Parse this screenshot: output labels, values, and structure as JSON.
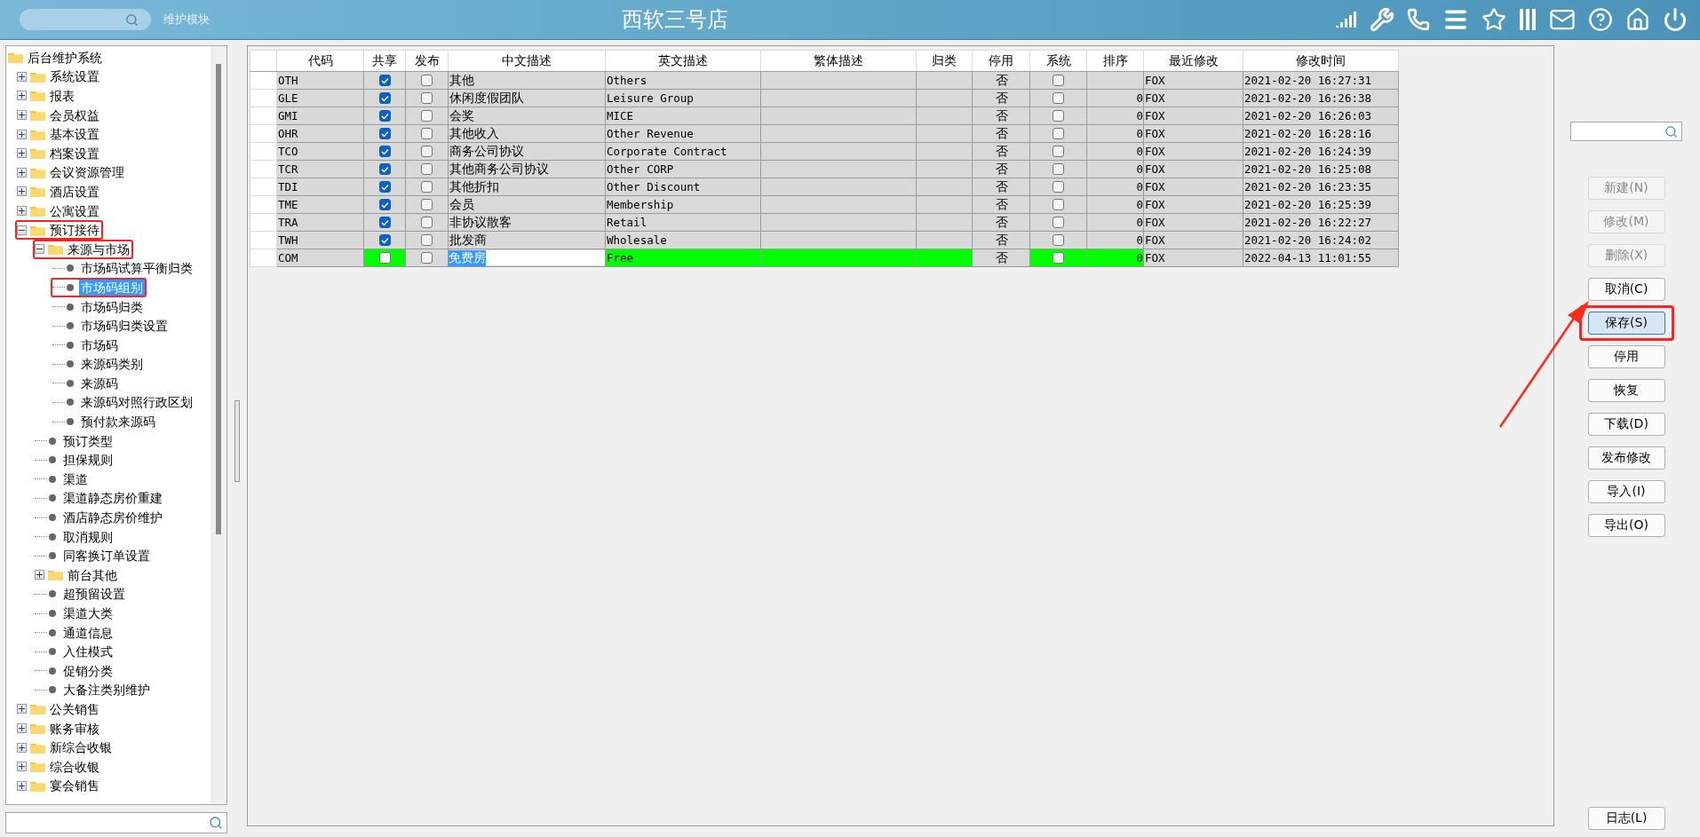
{
  "header": {
    "module_label": "维护模块",
    "title": "西软三号店"
  },
  "tree": {
    "label": "后台维护系统",
    "kind": "folder",
    "children": [
      {
        "label": "系统设置",
        "kind": "folder",
        "expanded": false
      },
      {
        "label": "报表",
        "kind": "folder",
        "expanded": false
      },
      {
        "label": "会员权益",
        "kind": "folder",
        "expanded": false
      },
      {
        "label": "基本设置",
        "kind": "folder",
        "expanded": false
      },
      {
        "label": "档案设置",
        "kind": "folder",
        "expanded": false
      },
      {
        "label": "会议资源管理",
        "kind": "folder",
        "expanded": false
      },
      {
        "label": "酒店设置",
        "kind": "folder",
        "expanded": false
      },
      {
        "label": "公寓设置",
        "kind": "folder",
        "expanded": false
      },
      {
        "label": "预订接待",
        "kind": "folder",
        "expanded": true,
        "highlighted": true,
        "children": [
          {
            "label": "来源与市场",
            "kind": "folder",
            "expanded": true,
            "highlighted": true,
            "children": [
              {
                "label": "市场码试算平衡归类",
                "kind": "leaf",
                "selected": false
              },
              {
                "label": "市场码组别",
                "kind": "leaf",
                "selected": true,
                "highlighted": true
              },
              {
                "label": "市场码归类",
                "kind": "leaf",
                "selected": false
              },
              {
                "label": "市场码归类设置",
                "kind": "leaf",
                "selected": false
              },
              {
                "label": "市场码",
                "kind": "leaf",
                "selected": false
              },
              {
                "label": "来源码类别",
                "kind": "leaf",
                "selected": false
              },
              {
                "label": "来源码",
                "kind": "leaf",
                "selected": false
              },
              {
                "label": "来源码对照行政区划",
                "kind": "leaf",
                "selected": false
              },
              {
                "label": "预付款来源码",
                "kind": "leaf",
                "selected": false
              }
            ]
          },
          {
            "label": "预订类型",
            "kind": "leaf",
            "selected": false
          },
          {
            "label": "担保规则",
            "kind": "leaf",
            "selected": false
          },
          {
            "label": "渠道",
            "kind": "leaf",
            "selected": false
          },
          {
            "label": "渠道静态房价重建",
            "kind": "leaf",
            "selected": false
          },
          {
            "label": "酒店静态房价维护",
            "kind": "leaf",
            "selected": false
          },
          {
            "label": "取消规则",
            "kind": "leaf",
            "selected": false
          },
          {
            "label": "同客换订单设置",
            "kind": "leaf",
            "selected": false
          },
          {
            "label": "前台其他",
            "kind": "folder",
            "expanded": false
          },
          {
            "label": "超预留设置",
            "kind": "leaf",
            "selected": false
          },
          {
            "label": "渠道大类",
            "kind": "leaf",
            "selected": false
          },
          {
            "label": "通道信息",
            "kind": "leaf",
            "selected": false
          },
          {
            "label": "入住模式",
            "kind": "leaf",
            "selected": false
          },
          {
            "label": "促销分类",
            "kind": "leaf",
            "selected": false
          },
          {
            "label": "大备注类别维护",
            "kind": "leaf",
            "selected": false
          }
        ]
      },
      {
        "label": "公关销售",
        "kind": "folder",
        "expanded": false
      },
      {
        "label": "账务审核",
        "kind": "folder",
        "expanded": false
      },
      {
        "label": "新综合收银",
        "kind": "folder",
        "expanded": false
      },
      {
        "label": "综合收银",
        "kind": "folder",
        "expanded": false
      },
      {
        "label": "宴会销售",
        "kind": "folder",
        "expanded": false
      }
    ]
  },
  "table": {
    "columns": [
      "代码",
      "共享",
      "发布",
      "中文描述",
      "英文描述",
      "繁体描述",
      "归类",
      "停用",
      "系统",
      "排序",
      "最近修改",
      "修改时间"
    ],
    "rows": [
      {
        "code": "OTH",
        "shared": true,
        "published": false,
        "name_zh": "其他",
        "name_en": "Others",
        "disabled": "否",
        "system": false,
        "modified_by": "FOX",
        "modified_at": "2021-02-20 16:27:31",
        "editing": false
      },
      {
        "code": "GLE",
        "shared": true,
        "published": false,
        "name_zh": "休闲度假团队",
        "name_en": "Leisure Group",
        "disabled": "否",
        "system": false,
        "sort": "0",
        "modified_by": "FOX",
        "modified_at": "2021-02-20 16:26:38",
        "editing": false
      },
      {
        "code": "GMI",
        "shared": true,
        "published": false,
        "name_zh": "会奖",
        "name_en": "MICE",
        "disabled": "否",
        "system": false,
        "sort": "0",
        "modified_by": "FOX",
        "modified_at": "2021-02-20 16:26:03",
        "editing": false
      },
      {
        "code": "OHR",
        "shared": true,
        "published": false,
        "name_zh": "其他收入",
        "name_en": "Other Revenue",
        "disabled": "否",
        "system": false,
        "sort": "0",
        "modified_by": "FOX",
        "modified_at": "2021-02-20 16:28:16",
        "editing": false
      },
      {
        "code": "TCO",
        "shared": true,
        "published": false,
        "name_zh": "商务公司协议",
        "name_en": "Corporate Contract",
        "disabled": "否",
        "system": false,
        "sort": "0",
        "modified_by": "FOX",
        "modified_at": "2021-02-20 16:24:39",
        "editing": false
      },
      {
        "code": "TCR",
        "shared": true,
        "published": false,
        "name_zh": "其他商务公司协议",
        "name_en": "Other CORP",
        "disabled": "否",
        "system": false,
        "sort": "0",
        "modified_by": "FOX",
        "modified_at": "2021-02-20 16:25:08",
        "editing": false
      },
      {
        "code": "TDI",
        "shared": true,
        "published": false,
        "name_zh": "其他折扣",
        "name_en": "Other Discount",
        "disabled": "否",
        "system": false,
        "sort": "0",
        "modified_by": "FOX",
        "modified_at": "2021-02-20 16:23:35",
        "editing": false
      },
      {
        "code": "TME",
        "shared": true,
        "published": false,
        "name_zh": "会员",
        "name_en": "Membership",
        "disabled": "否",
        "system": false,
        "sort": "0",
        "modified_by": "FOX",
        "modified_at": "2021-02-20 16:25:39",
        "editing": false
      },
      {
        "code": "TRA",
        "shared": true,
        "published": false,
        "name_zh": "非协议散客",
        "name_en": "Retail",
        "disabled": "否",
        "system": false,
        "sort": "0",
        "modified_by": "FOX",
        "modified_at": "2021-02-20 16:22:27",
        "editing": false
      },
      {
        "code": "TWH",
        "shared": true,
        "published": false,
        "name_zh": "批发商",
        "name_en": "Wholesale",
        "disabled": "否",
        "system": false,
        "sort": "0",
        "modified_by": "FOX",
        "modified_at": "2021-02-20 16:24:02",
        "editing": false
      },
      {
        "code": "COM",
        "shared": false,
        "published": false,
        "name_zh": "免费房",
        "name_en": "Free",
        "disabled": "否",
        "system": false,
        "sort": "0",
        "modified_by": "FOX",
        "modified_at": "2022-04-13 11:01:55",
        "editing": true
      }
    ]
  },
  "actions": [
    {
      "label": "新建(N)",
      "disabled": true,
      "focused": false,
      "highlighted": false
    },
    {
      "label": "修改(M)",
      "disabled": true,
      "focused": false,
      "highlighted": false
    },
    {
      "label": "删除(X)",
      "disabled": true,
      "focused": false,
      "highlighted": false
    },
    {
      "label": "取消(C)",
      "disabled": false,
      "focused": false,
      "highlighted": false
    },
    {
      "label": "保存(S)",
      "disabled": false,
      "focused": true,
      "highlighted": true
    },
    {
      "label": "停用",
      "disabled": false,
      "focused": false,
      "highlighted": false
    },
    {
      "label": "恢复",
      "disabled": false,
      "focused": false,
      "highlighted": false
    },
    {
      "label": "下载(D)",
      "disabled": false,
      "focused": false,
      "highlighted": false
    },
    {
      "label": "发布修改",
      "disabled": false,
      "focused": false,
      "highlighted": false
    },
    {
      "label": "导入(I)",
      "disabled": false,
      "focused": false,
      "highlighted": false
    },
    {
      "label": "导出(O)",
      "disabled": false,
      "focused": false,
      "highlighted": false
    }
  ],
  "log_button": {
    "label": "日志(L)"
  }
}
